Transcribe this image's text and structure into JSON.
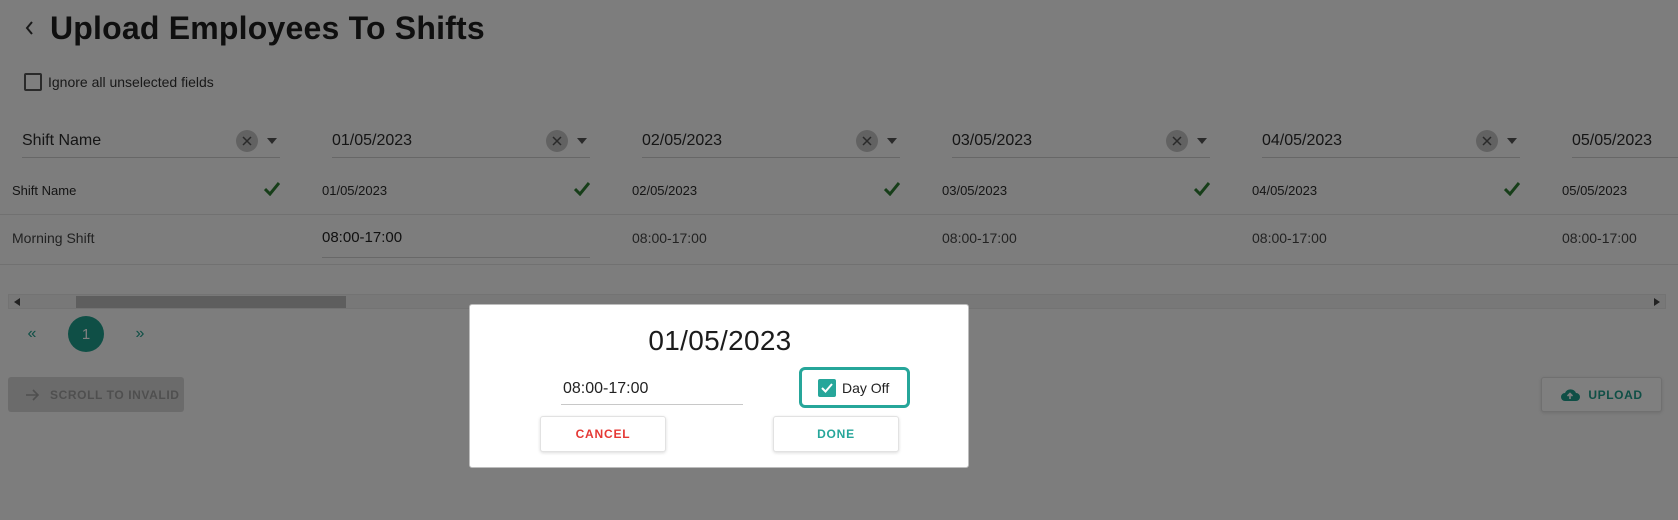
{
  "page": {
    "title": "Upload Employees To Shifts",
    "ignore_label": "Ignore all unselected fields"
  },
  "columns": [
    {
      "header": "Shift Name",
      "row1": "Shift Name",
      "row2": "Morning Shift"
    },
    {
      "header": "01/05/2023",
      "row1": "01/05/2023",
      "row2": "08:00-17:00"
    },
    {
      "header": "02/05/2023",
      "row1": "02/05/2023",
      "row2": "08:00-17:00"
    },
    {
      "header": "03/05/2023",
      "row1": "03/05/2023",
      "row2": "08:00-17:00"
    },
    {
      "header": "04/05/2023",
      "row1": "04/05/2023",
      "row2": "08:00-17:00"
    },
    {
      "header": "05/05/2023",
      "row1": "05/05/2023",
      "row2": "08:00-17:00"
    }
  ],
  "pagination": {
    "prev": "«",
    "current": "1",
    "next": "»"
  },
  "buttons": {
    "scroll_to_invalid": "SCROLL TO INVALID",
    "upload": "UPLOAD"
  },
  "dialog": {
    "title": "01/05/2023",
    "time_value": "08:00-17:00",
    "day_off_label": "Day Off",
    "day_off_checked": true,
    "cancel_label": "CANCEL",
    "done_label": "DONE"
  },
  "colors": {
    "accent": "#26a69a",
    "check_green": "#2e7d32",
    "cancel_red": "#e53935",
    "overlay": "rgba(0,0,0,0.5)"
  },
  "icons": {
    "back": "chevron-left-icon",
    "clear": "clear-circle-icon",
    "dropdown": "caret-down-icon",
    "valid": "check-icon",
    "scroll": "arrow-right-icon",
    "upload": "cloud-upload-icon"
  }
}
